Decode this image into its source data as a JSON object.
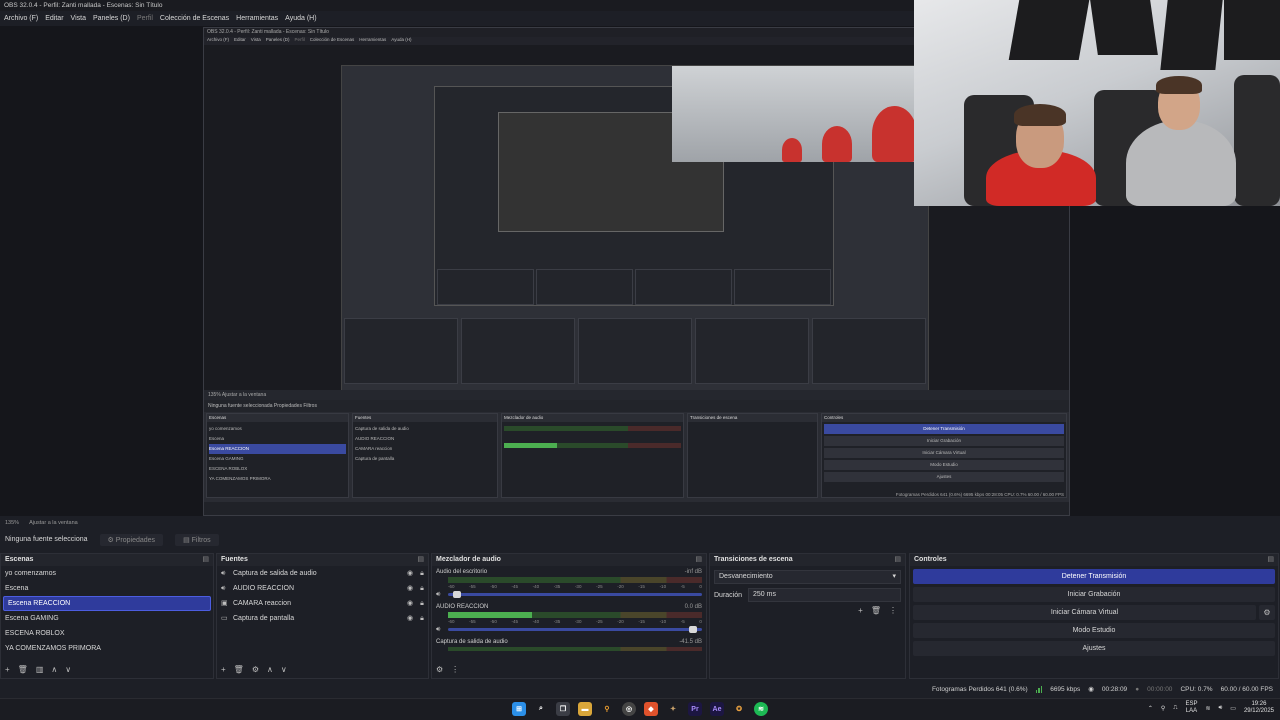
{
  "window": {
    "title": "OBS 32.0.4 - Perfil: Zanti mallada - Escenas: Sin Título"
  },
  "menu": [
    {
      "label": "Archivo (F)",
      "dim": false
    },
    {
      "label": "Editar",
      "dim": false
    },
    {
      "label": "Vista",
      "dim": false
    },
    {
      "label": "Paneles (D)",
      "dim": false
    },
    {
      "label": "Perfil",
      "dim": true
    },
    {
      "label": "Colección de Escenas",
      "dim": false
    },
    {
      "label": "Herramientas",
      "dim": false
    },
    {
      "label": "Ayuda (H)",
      "dim": false
    }
  ],
  "preview": {
    "zoom": "135%",
    "fit_label": "Ajustar a la ventana",
    "nested": {
      "title": "OBS 32.0.4 - Perfil: Zanti mallada - Escenas: Sin Título",
      "menu": [
        "Archivo (F)",
        "Editar",
        "Vista",
        "Paneles (D)",
        "Perfil",
        "Colección de Escenas",
        "Herramientas",
        "Ayuda (H)"
      ],
      "zoom_bar": "135%   Ajustar a la ventana",
      "selection": "Ninguna fuente seleccionada   Propiedades   Filtros",
      "scenes_header": "Escenas",
      "scenes": [
        "yo comenzamos",
        "Escena",
        "Escena REACCION",
        "Escena GAMING",
        "ESCENA ROBLOX",
        "YA COMENZAMOS PRIMORA"
      ],
      "sources_header": "Fuentes",
      "sources": [
        "Captura de salida de audio",
        "AUDIO REACCION",
        "CAMARA reaccion",
        "Captura de pantalla"
      ],
      "mixer_header": "Mezclador de audio",
      "transitions_header": "Transiciones de escena",
      "controls_header": "Controles",
      "controls": [
        "Detener Transmisión",
        "Iniciar Grabación",
        "Iniciar Cámara Virtual",
        "Modo Estudio",
        "Ajustes"
      ],
      "status": "Fotogramas Perdidos 641 (0.6%)   6695 kbps   00:28:05   CPU: 0.7%   60.00 / 60.00 FPS"
    }
  },
  "selection_bar": {
    "label": "Ninguna fuente selecciona",
    "properties": "Propiedades",
    "filters": "Filtros"
  },
  "scenes": {
    "title": "Escenas",
    "items": [
      {
        "label": "yo comenzamos",
        "selected": false
      },
      {
        "label": "Escena",
        "selected": false
      },
      {
        "label": "Escena REACCION",
        "selected": true
      },
      {
        "label": "Escena GAMING",
        "selected": false
      },
      {
        "label": "ESCENA ROBLOX",
        "selected": false
      },
      {
        "label": "YA COMENZAMOS PRIMORA",
        "selected": false
      }
    ]
  },
  "sources": {
    "title": "Fuentes",
    "items": [
      {
        "label": "Captura de salida de audio",
        "icon": "speaker-icon"
      },
      {
        "label": "AUDIO REACCION",
        "icon": "speaker-icon"
      },
      {
        "label": "CAMARA reaccion",
        "icon": "camera-icon"
      },
      {
        "label": "Captura de pantalla",
        "icon": "monitor-icon"
      }
    ]
  },
  "mixer": {
    "title": "Mezclador de audio",
    "scale": [
      "-60",
      "-55",
      "-50",
      "-45",
      "-40",
      "-35",
      "-30",
      "-25",
      "-20",
      "-15",
      "-10",
      "-5",
      "0"
    ],
    "channels": [
      {
        "name": "Audio del escritorio",
        "db": "-inf dB",
        "level": 0.0,
        "volume": 0.02
      },
      {
        "name": "AUDIO REACCION",
        "db": "0.0 dB",
        "level": 0.33,
        "volume": 0.98
      },
      {
        "name": "Captura de salida de audio",
        "db": "-41.5 dB",
        "level": 0.0,
        "volume": 0.0
      }
    ]
  },
  "transitions": {
    "title": "Transiciones de escena",
    "selected": "Desvanecimiento",
    "duration_label": "Duración",
    "duration_value": "250 ms"
  },
  "controls": {
    "title": "Controles",
    "stop_stream": "Detener Transmisión",
    "start_record": "Iniciar Grabación",
    "virtual_cam": "Iniciar Cámara Virtual",
    "studio_mode": "Modo Estudio",
    "settings": "Ajustes"
  },
  "status": {
    "dropped": "Fotogramas Perdidos 641 (0.6%)",
    "bitrate": "6695 kbps",
    "stream_time": "00:28:09",
    "record_time": "00:00:00",
    "cpu": "CPU: 0.7%",
    "fps": "60.00 / 60.00 FPS"
  },
  "taskbar": {
    "lang": "ESP",
    "lang2": "LAA",
    "time": "19:26",
    "date": "29/12/2025"
  },
  "colors": {
    "accent": "#2f3b9c",
    "meter_green": "#4caf50"
  }
}
